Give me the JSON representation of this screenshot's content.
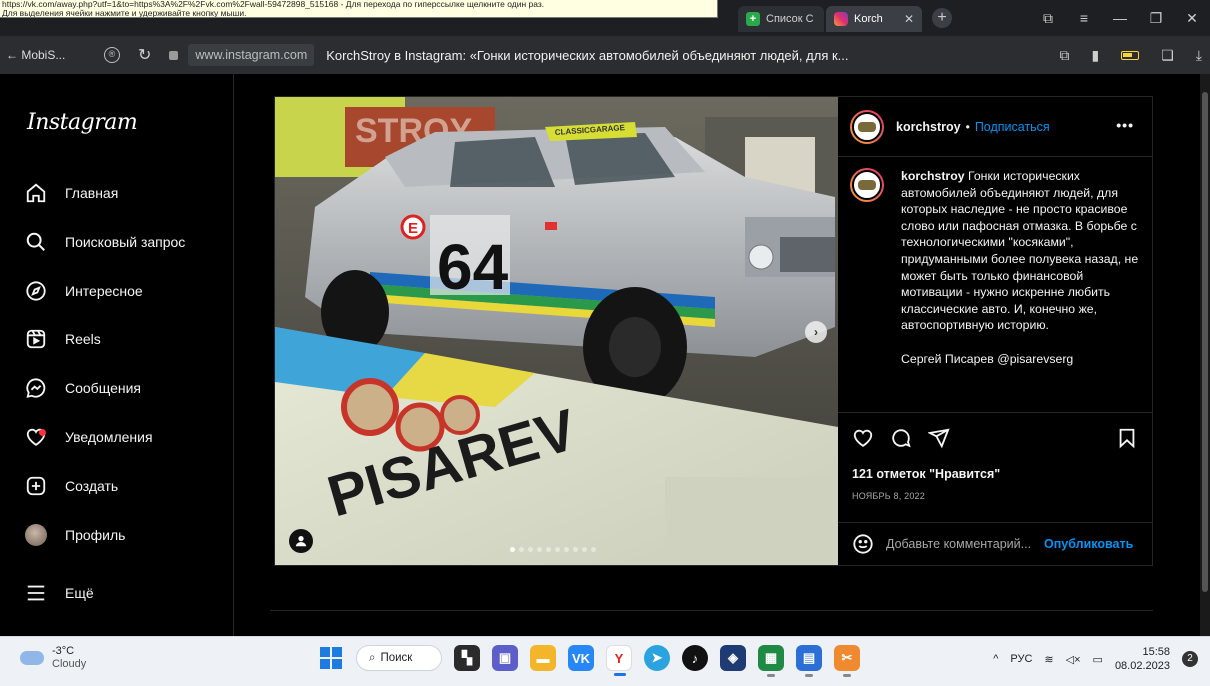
{
  "tooltip": {
    "line1": "https://vk.com/away.php?utf=1&to=https%3A%2F%2Fvk.com%2Fwall-59472898_515168 - Для перехода по гиперссылке щелкните один раз.",
    "line2": "Для выделения ячейки нажмите и удерживайте кнопку мыши."
  },
  "tabs": [
    {
      "label": "Список С",
      "favicon": "green-plus-icon"
    },
    {
      "label": "Korch",
      "favicon": "instagram-icon"
    }
  ],
  "address": {
    "back_label": "← MobiS...",
    "host": "www.instagram.com",
    "title": "KorchStroy в Instagram: «Гонки исторических автомобилей объединяют людей, для к..."
  },
  "instagram": {
    "logo": "Instagram",
    "nav": [
      {
        "label": "Главная",
        "icon": "home-icon"
      },
      {
        "label": "Поисковый запрос",
        "icon": "search-icon"
      },
      {
        "label": "Интересное",
        "icon": "compass-icon"
      },
      {
        "label": "Reels",
        "icon": "reels-icon"
      },
      {
        "label": "Сообщения",
        "icon": "messenger-icon"
      },
      {
        "label": "Уведомления",
        "icon": "heart-icon"
      },
      {
        "label": "Создать",
        "icon": "plus-square-icon"
      },
      {
        "label": "Профиль",
        "icon": "avatar"
      },
      {
        "label": "Ещё",
        "icon": "menu-icon"
      }
    ],
    "post": {
      "username": "korchstroy",
      "follow_label": "Подписаться",
      "more_label": "•••",
      "caption_user": "korchstroy",
      "caption_text": " Гонки исторических автомобилей объединяют людей, для которых наследие - не просто красивое слово или пафосная отмазка. В борьбе с технологическими \"косяками\", придуманными более полувека назад, не может быть только финансовой мотивации - нужно искренне любить классические авто. И, конечно же, автоспортивную историю.",
      "signature": "Сергей Писарев @pisarevserg",
      "likes": "121 отметок \"Нравится\"",
      "date": "НОЯБРЬ 8, 2022",
      "comment_placeholder": "Добавьте комментарий...",
      "publish_label": "Опубликовать",
      "carousel_total": 10,
      "carousel_index": 1,
      "photo_texts": {
        "car_number": "64",
        "car_letter": "E",
        "banner_text": "PISAREV",
        "wall_text": "STROY",
        "windshield_text": "CLASSICGARAGE"
      }
    }
  },
  "taskbar": {
    "temp": "-3°C",
    "weather": "Cloudy",
    "search_label": "Поиск",
    "lang": "РУС",
    "time": "15:58",
    "date": "08.02.2023",
    "notifications": "2"
  },
  "colors": {
    "accent_blue": "#0095f6",
    "notification_red": "#ff3040"
  }
}
